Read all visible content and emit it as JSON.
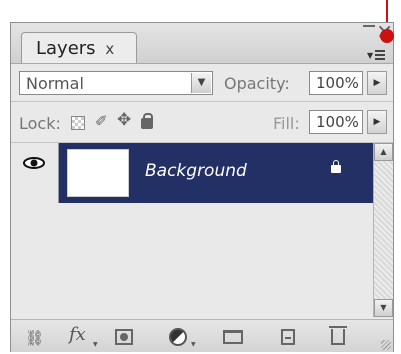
{
  "panel": {
    "tab_label": "Layers",
    "tab_close": "x",
    "window_close": "×"
  },
  "blend_mode": {
    "value": "Normal"
  },
  "opacity": {
    "label": "Opacity:",
    "value": "100%"
  },
  "lock": {
    "label": "Lock:"
  },
  "fill": {
    "label": "Fill:",
    "value": "100%"
  },
  "layers": [
    {
      "name": "Background",
      "visible": true,
      "locked": true,
      "selected": true
    }
  ],
  "bottom_icons": [
    "link-layers-icon",
    "fx-icon",
    "layer-mask-icon",
    "adjustment-layer-icon",
    "new-group-icon",
    "new-layer-icon",
    "trash-icon"
  ],
  "colors": {
    "selected_row": "#223066",
    "annotation": "#cc1111"
  }
}
